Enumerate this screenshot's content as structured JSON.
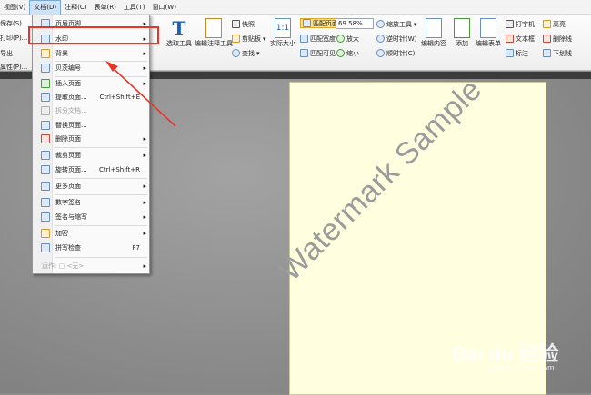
{
  "menubar": [
    "视图(V)",
    "文档(D)",
    "注释(C)",
    "表单(R)",
    "工具(T)",
    "窗口(W)"
  ],
  "left_cut": [
    "保存(S)",
    "打印(P)...",
    "导出",
    "属性(P)..."
  ],
  "ribbon": {
    "selection_tool": "选择工具",
    "select_annotation": "选取工具",
    "edit_annotation": "编辑注释工具",
    "snapshot": "快照",
    "clipboard": "剪贴板",
    "find": "查找",
    "actual_size": "实际大小",
    "fit_page": "匹配页面",
    "fit_width": "匹配宽度",
    "fit_visible": "匹配可见",
    "zoom_value": "69.58%",
    "zoom_in": "放大",
    "zoom_out": "缩小",
    "zoom_tool": "缩放工具",
    "rotate_ccw": "逆时针(W)",
    "rotate_cw": "顺时针(C)",
    "edit_content": "编辑内容",
    "add": "添加",
    "edit_form": "编辑表单",
    "typewriter": "打字机",
    "textbox": "文本框",
    "note": "标注",
    "highlight": "高亮",
    "strikeout": "删除线",
    "underline": "下划线"
  },
  "menu": {
    "items": [
      {
        "label": "页眉页脚",
        "arrow": "▸"
      },
      {
        "label": "水印",
        "arrow": "▸"
      },
      {
        "label": "背景",
        "arrow": "▸"
      },
      {
        "label": "贝茨编号",
        "arrow": "▸"
      },
      {
        "label": "插入页面",
        "arrow": "▸"
      },
      {
        "label": "提取页面...",
        "shortcut": "Ctrl+Shift+E"
      },
      {
        "label": "拆分文档...",
        "disabled": true
      },
      {
        "label": "替换页面..."
      },
      {
        "label": "删除页面",
        "arrow": "▸"
      },
      {
        "label": "裁剪页面",
        "arrow": "▸"
      },
      {
        "label": "旋转页面...",
        "shortcut": "Ctrl+Shift+R"
      },
      {
        "label": "更多页面",
        "arrow": "▸"
      },
      {
        "label": "数字签名",
        "arrow": "▸"
      },
      {
        "label": "签名与缩写",
        "arrow": "▸"
      },
      {
        "label": "加密",
        "arrow": "▸"
      },
      {
        "label": "拼写检查",
        "shortcut": "F7"
      },
      {
        "label": "运作: ▢ <无>",
        "arrow": "▸",
        "disabled": true
      }
    ]
  },
  "document": {
    "watermark_text": "Watermark Sample"
  },
  "site_mark": {
    "brand": "Bai du 经验",
    "url": "jingyan.baidu.com"
  },
  "colors": {
    "highlight_box": "#e8352b",
    "page_bg": "#ffffe0"
  }
}
